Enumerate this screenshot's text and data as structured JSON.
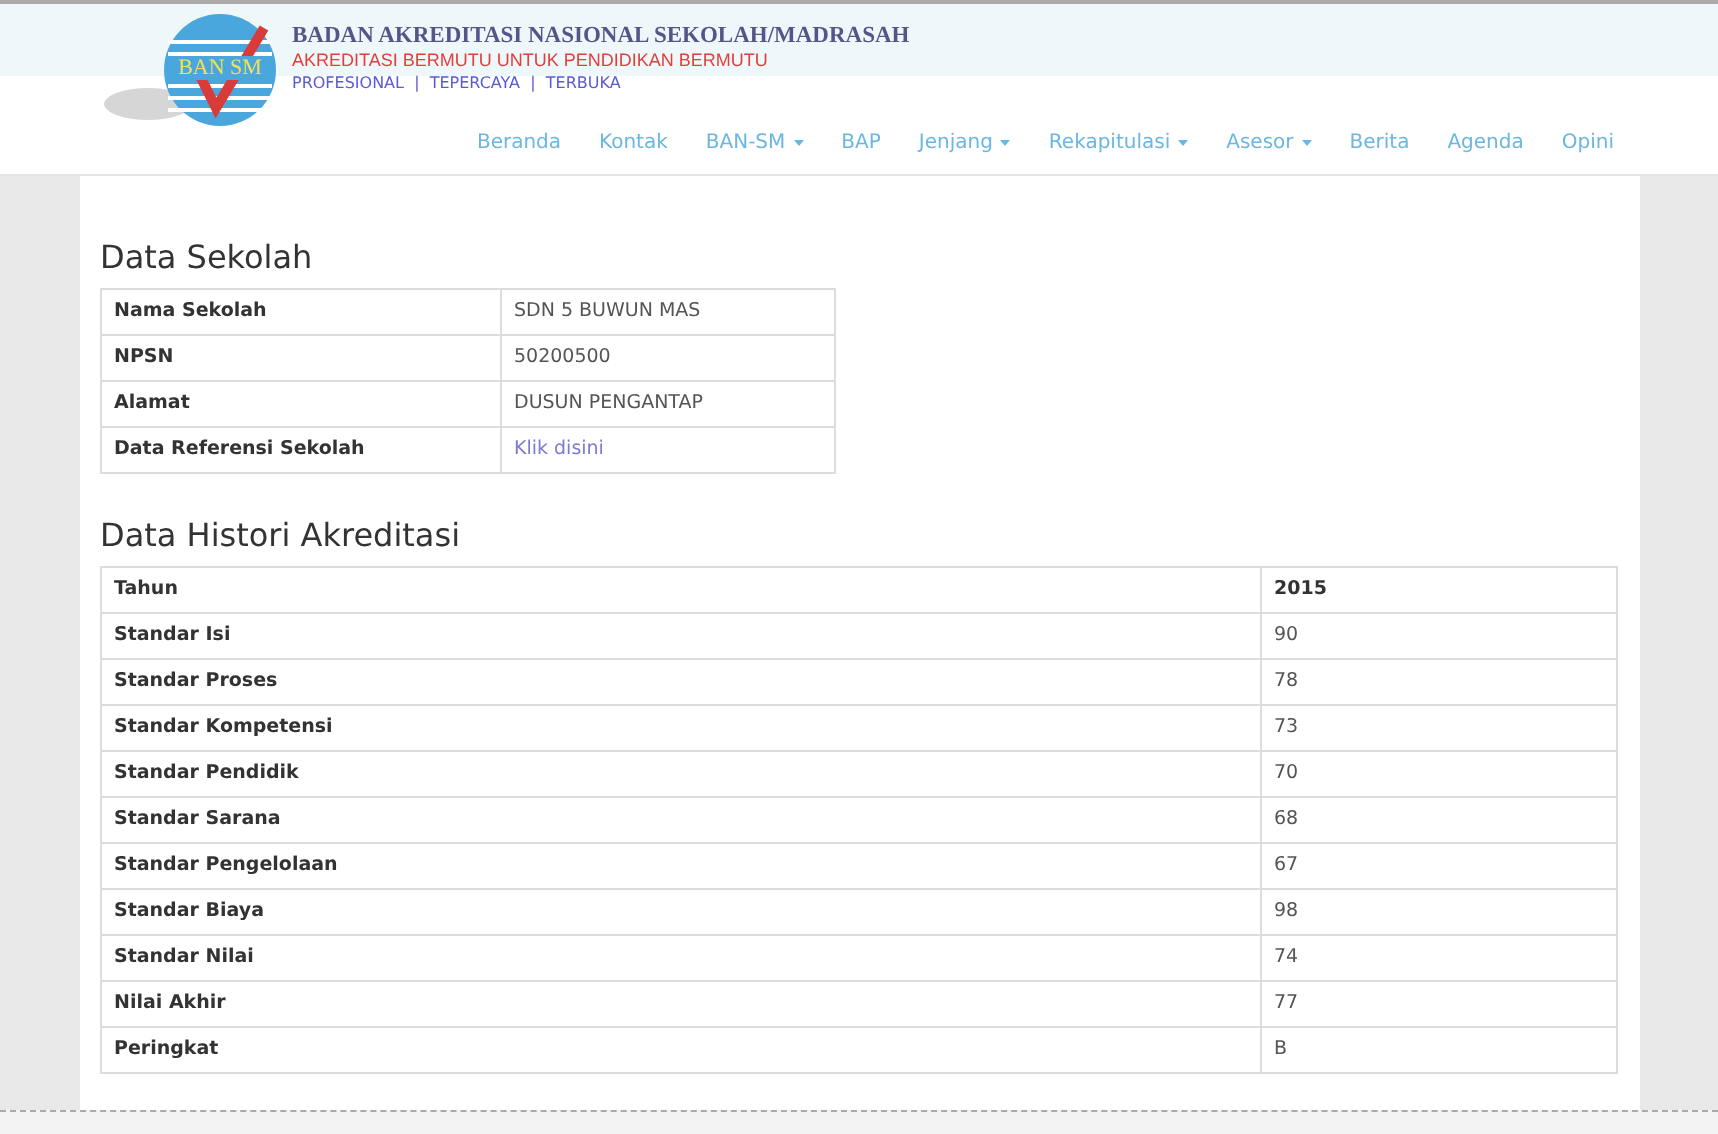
{
  "header": {
    "logo_text": "BAN SM",
    "title": "BADAN AKREDITASI NASIONAL SEKOLAH/MADRASAH",
    "tagline": "AKREDITASI BERMUTU UNTUK PENDIDIKAN BERMUTU",
    "motto": "PROFESIONAL  |  TEPERCAYA  |  TERBUKA"
  },
  "nav": [
    {
      "label": "Beranda",
      "kind": "link"
    },
    {
      "label": "Kontak",
      "kind": "link"
    },
    {
      "label": "BAN-SM",
      "kind": "dropdown"
    },
    {
      "label": "BAP",
      "kind": "link"
    },
    {
      "label": "Jenjang",
      "kind": "dropdown"
    },
    {
      "label": "Rekapitulasi",
      "kind": "dropdown"
    },
    {
      "label": "Asesor",
      "kind": "dropdown"
    },
    {
      "label": "Berita",
      "kind": "link"
    },
    {
      "label": "Agenda",
      "kind": "link"
    },
    {
      "label": "Opini",
      "kind": "link"
    }
  ],
  "data_sekolah": {
    "title": "Data Sekolah",
    "rows": [
      {
        "label": "Nama Sekolah",
        "value": "SDN 5 BUWUN MAS",
        "kind": "text"
      },
      {
        "label": "NPSN",
        "value": "50200500",
        "kind": "text"
      },
      {
        "label": "Alamat",
        "value": "DUSUN PENGANTAP",
        "kind": "text"
      },
      {
        "label": "Data Referensi Sekolah",
        "value": "Klik disini",
        "kind": "link"
      }
    ]
  },
  "histori": {
    "title": "Data Histori Akreditasi",
    "columns": [
      "Tahun",
      "2015"
    ],
    "rows": [
      [
        "Standar Isi",
        "90"
      ],
      [
        "Standar Proses",
        "78"
      ],
      [
        "Standar Kompetensi",
        "73"
      ],
      [
        "Standar Pendidik",
        "70"
      ],
      [
        "Standar Sarana",
        "68"
      ],
      [
        "Standar Pengelolaan",
        "67"
      ],
      [
        "Standar Biaya",
        "98"
      ],
      [
        "Standar Nilai",
        "74"
      ],
      [
        "Nilai Akhir",
        "77"
      ],
      [
        "Peringkat",
        "B"
      ]
    ]
  }
}
